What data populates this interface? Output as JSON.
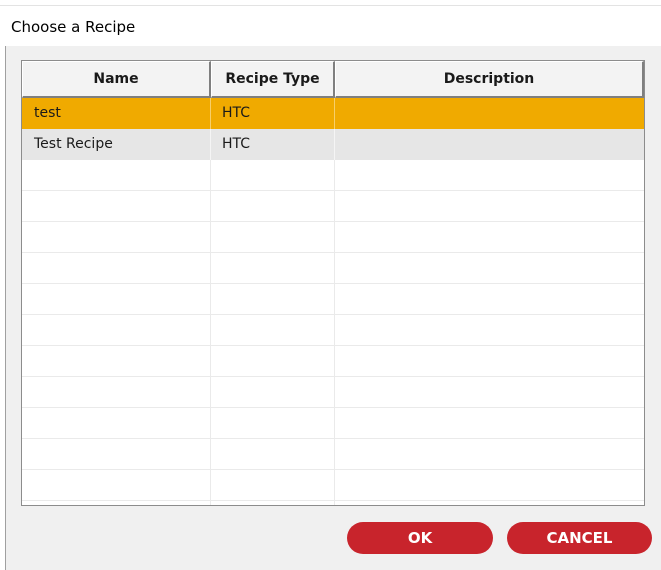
{
  "dialog": {
    "title": "Choose a Recipe"
  },
  "table": {
    "columns": [
      "Name",
      "Recipe Type",
      "Description"
    ],
    "rows": [
      {
        "name": "test",
        "recipe_type": "HTC",
        "description": "",
        "selected": true
      },
      {
        "name": "Test Recipe",
        "recipe_type": "HTC",
        "description": "",
        "selected": false
      }
    ],
    "selected_row_color": "#f0aa00"
  },
  "buttons": {
    "ok_label": "OK",
    "cancel_label": "CANCEL",
    "button_color": "#c8242c"
  }
}
